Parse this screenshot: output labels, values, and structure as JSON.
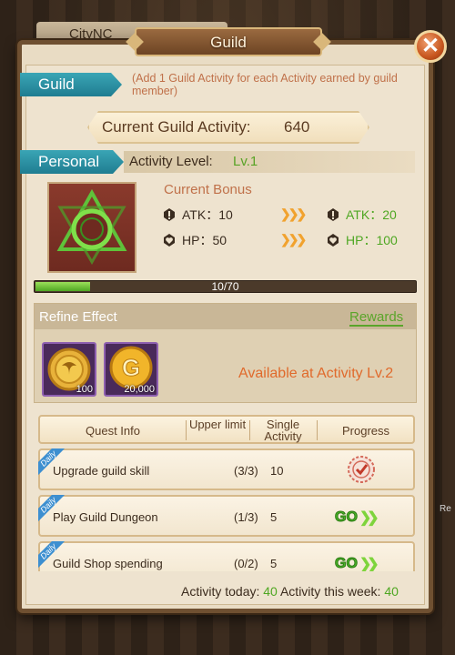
{
  "background": {
    "city_tab": "CityNC",
    "side_text": "Re"
  },
  "window": {
    "title": "Guild",
    "close_label": "✕"
  },
  "guild": {
    "label": "Guild",
    "note": "(Add 1 Guild Activity for each Activity earned by guild member)",
    "activity_label": "Current Guild Activity:",
    "activity_value": "640"
  },
  "personal": {
    "label": "Personal",
    "level_label": "Activity Level:",
    "level_value": "Lv.1",
    "bonus_title": "Current Bonus",
    "current": {
      "atk": "ATK：10",
      "hp": "HP：50"
    },
    "next": {
      "atk": "ATK：20",
      "hp": "HP：100"
    },
    "progress_text": "10/70",
    "progress_fraction": 0.143
  },
  "refine": {
    "title": "Refine Effect",
    "rewards_tab": "Rewards",
    "items": [
      {
        "icon": "guild-coin-icon",
        "count": "100"
      },
      {
        "icon": "gold-coin-icon",
        "count": "20,000"
      }
    ],
    "available_text": "Available at Activity Lv.2"
  },
  "quests": {
    "headers": {
      "info": "Quest Info",
      "upper": "Upper limit",
      "single": "Single Activity",
      "progress": "Progress"
    },
    "daily_tag": "Daily",
    "rows": [
      {
        "name": "Upgrade guild skill",
        "limit": "(3/3)",
        "single": "10",
        "state": "done"
      },
      {
        "name": "Play Guild Dungeon",
        "limit": "(1/3)",
        "single": "5",
        "state": "go",
        "go": "GO"
      },
      {
        "name": "Guild Shop spending",
        "limit": "(0/2)",
        "single": "5",
        "state": "go",
        "go": "GO"
      }
    ]
  },
  "footer": {
    "today_label": "Activity today:",
    "today_value": "40",
    "week_label": "Activity this week:",
    "week_value": "40"
  },
  "colors": {
    "accent_teal": "#1f7d91",
    "green": "#4ea722",
    "orange": "#e06a2c"
  }
}
